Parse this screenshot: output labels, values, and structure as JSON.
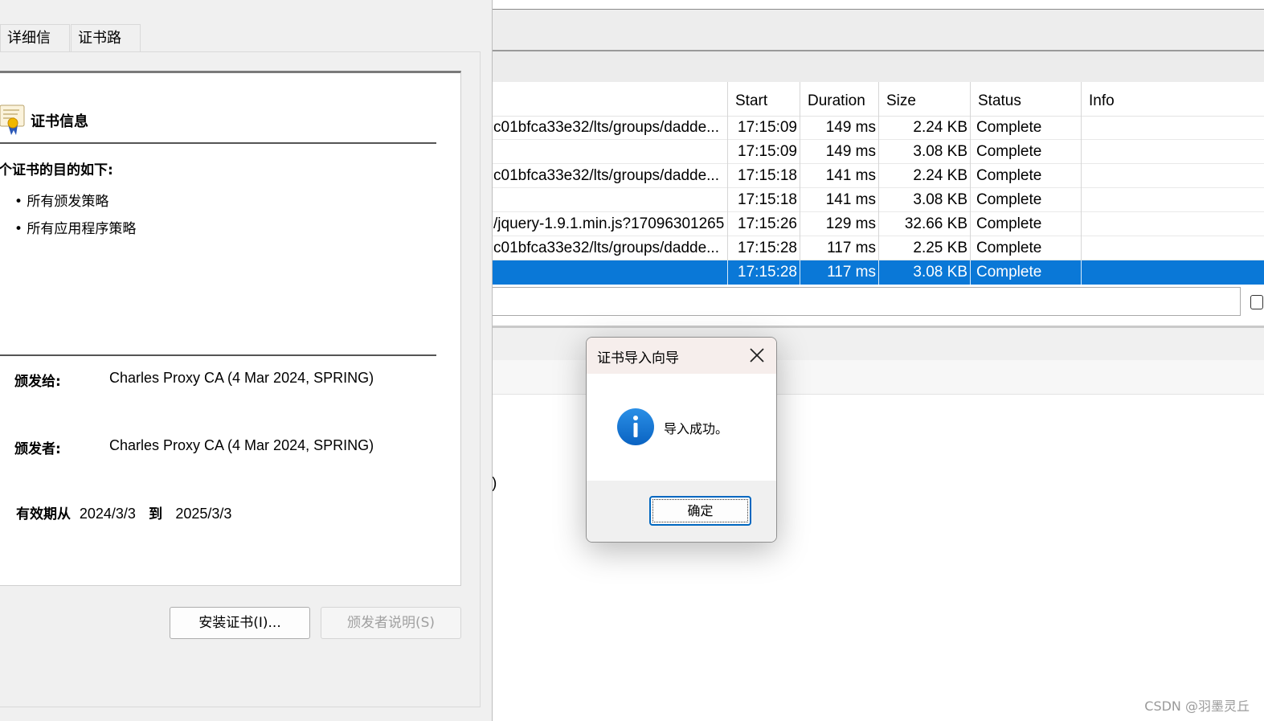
{
  "cert_dialog": {
    "tabs": [
      "详细信息",
      "证书路径"
    ],
    "section_title": "证书信息",
    "purpose_heading": "个证书的目的如下:",
    "purposes": [
      "• 所有颁发策略",
      "• 所有应用程序策略"
    ],
    "issued_to_label": "颁发给:",
    "issued_to_value": "Charles Proxy CA (4 Mar 2024, SPRING)",
    "issued_by_label": "颁发者:",
    "issued_by_value": "Charles Proxy CA (4 Mar 2024, SPRING)",
    "valid_from_label": "有效期从",
    "valid_from": "2024/3/3",
    "valid_to_label": "到",
    "valid_to": "2025/3/3",
    "install_button": "安装证书(I)...",
    "issuer_statement_button": "颁发者说明(S)"
  },
  "charles": {
    "columns": [
      "Start",
      "Duration",
      "Size",
      "Status",
      "Info"
    ],
    "rows": [
      {
        "url": "c01bfca33e32/lts/groups/dadde...",
        "start": "17:15:09",
        "duration": "149 ms",
        "size": "2.24 KB",
        "status": "Complete"
      },
      {
        "url": "",
        "start": "17:15:09",
        "duration": "149 ms",
        "size": "3.08 KB",
        "status": "Complete"
      },
      {
        "url": "c01bfca33e32/lts/groups/dadde...",
        "start": "17:15:18",
        "duration": "141 ms",
        "size": "2.24 KB",
        "status": "Complete"
      },
      {
        "url": "",
        "start": "17:15:18",
        "duration": "141 ms",
        "size": "3.08 KB",
        "status": "Complete"
      },
      {
        "url": "/jquery-1.9.1.min.js?17096301265",
        "start": "17:15:26",
        "duration": "129 ms",
        "size": "32.66 KB",
        "status": "Complete"
      },
      {
        "url": "c01bfca33e32/lts/groups/dadde...",
        "start": "17:15:28",
        "duration": "117 ms",
        "size": "2.25 KB",
        "status": "Complete"
      },
      {
        "url": "",
        "start": "17:15:28",
        "duration": "117 ms",
        "size": "3.08 KB",
        "status": "Complete"
      }
    ],
    "selected_row_index": 6,
    "selection_color": "#0a78d7",
    "stray_text": ")"
  },
  "message_box": {
    "title": "证书导入向导",
    "message": "导入成功。",
    "ok_button": "确定",
    "icon": "info-icon",
    "close_icon": "close-icon"
  },
  "watermark": "CSDN @羽墨灵丘"
}
